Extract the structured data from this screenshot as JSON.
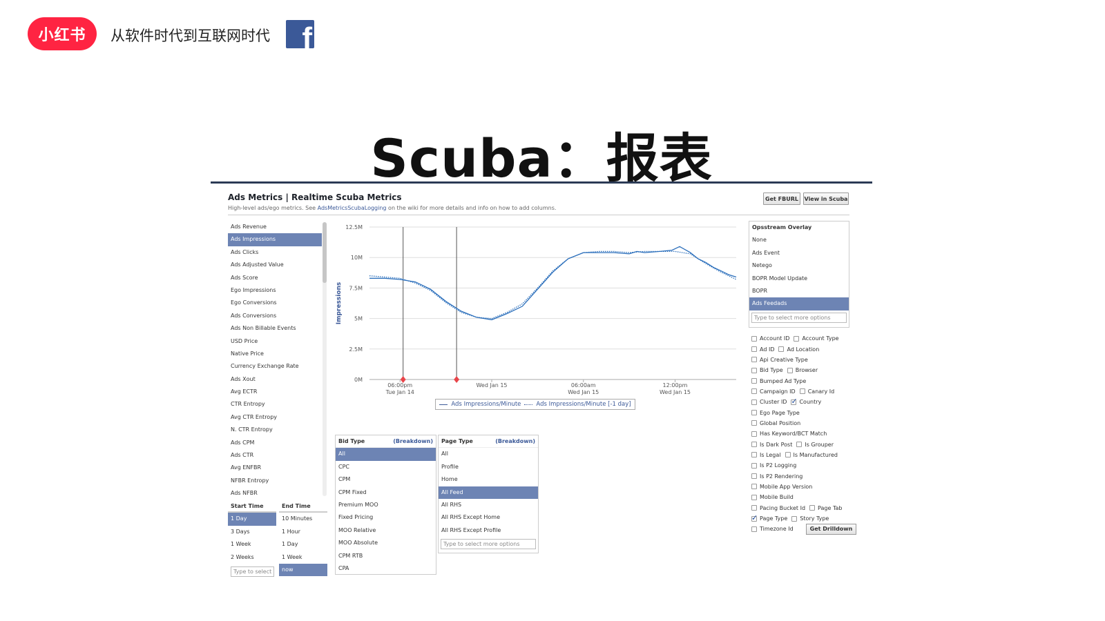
{
  "slide": {
    "brand": "小红书",
    "subtitle": "从软件时代到互联网时代",
    "title": "Scuba：报表",
    "fb_logo": "f"
  },
  "app": {
    "title": "Ads Metrics | Realtime Scuba Metrics",
    "desc_pre": "High-level ads/ego metrics. See ",
    "desc_link": "AdsMetricsScubaLogging",
    "desc_post": " on the wiki for more details and info on how to add columns.",
    "buttons": {
      "fburl": "Get FBURL",
      "view": "View in Scuba"
    }
  },
  "metrics": [
    "Ads Revenue",
    "Ads Impressions",
    "Ads Clicks",
    "Ads Adjusted Value",
    "Ads Score",
    "Ego Impressions",
    "Ego Conversions",
    "Ads Conversions",
    "Ads Non Billable Events",
    "USD Price",
    "Native Price",
    "Currency Exchange Rate",
    "Ads Xout",
    "Avg ECTR",
    "CTR Entropy",
    "Avg CTR Entropy",
    "N. CTR Entropy",
    "Ads CPM",
    "Ads CTR",
    "Avg ENFBR",
    "NFBR Entropy",
    "Ads NFBR"
  ],
  "metrics_selected": 1,
  "start_time": {
    "header": "Start Time",
    "items": [
      "1 Day",
      "3 Days",
      "1 Week",
      "2 Weeks"
    ],
    "selected": 0,
    "placeholder": "Type to select"
  },
  "end_time": {
    "header": "End Time",
    "items": [
      "10 Minutes",
      "1 Hour",
      "1 Day",
      "1 Week",
      "now"
    ],
    "selected": 4
  },
  "bid_type": {
    "header": "Bid Type",
    "breakdown": "(Breakdown)",
    "items": [
      "All",
      "CPC",
      "CPM",
      "CPM Fixed",
      "Premium MOO",
      "Fixed Pricing",
      "MOO Relative",
      "MOO Absolute",
      "CPM RTB",
      "CPA"
    ],
    "selected": 0
  },
  "page_type": {
    "header": "Page Type",
    "breakdown": "(Breakdown)",
    "items": [
      "All",
      "Profile",
      "Home",
      "All Feed",
      "All RHS",
      "All RHS Except Home",
      "All RHS Except Profile"
    ],
    "selected": 3,
    "placeholder": "Type to select more options"
  },
  "overlay": {
    "header": "Opsstream Overlay",
    "items": [
      "None",
      "Ads Event",
      "Netego",
      "BOPR Model Update",
      "BOPR",
      "Ads Feedads"
    ],
    "selected": 5,
    "placeholder": "Type to select more options"
  },
  "checkbox_rows": [
    [
      {
        "label": "Account ID",
        "checked": false
      },
      {
        "label": "Account Type",
        "checked": false
      }
    ],
    [
      {
        "label": "Ad ID",
        "checked": false
      },
      {
        "label": "Ad Location",
        "checked": false
      }
    ],
    [
      {
        "label": "Api Creative Type",
        "checked": false
      }
    ],
    [
      {
        "label": "Bid Type",
        "checked": false
      },
      {
        "label": "Browser",
        "checked": false
      }
    ],
    [
      {
        "label": "Bumped Ad Type",
        "checked": false
      }
    ],
    [
      {
        "label": "Campaign ID",
        "checked": false
      },
      {
        "label": "Canary Id",
        "checked": false
      }
    ],
    [
      {
        "label": "Cluster ID",
        "checked": false
      },
      {
        "label": "Country",
        "checked": true
      }
    ],
    [
      {
        "label": "Ego Page Type",
        "checked": false
      }
    ],
    [
      {
        "label": "Global Position",
        "checked": false
      }
    ],
    [
      {
        "label": "Has Keyword/BCT Match",
        "checked": false
      }
    ],
    [
      {
        "label": "Is Dark Post",
        "checked": false
      },
      {
        "label": "Is Grouper",
        "checked": false
      }
    ],
    [
      {
        "label": "Is Legal",
        "checked": false
      },
      {
        "label": "Is Manufactured",
        "checked": false
      }
    ],
    [
      {
        "label": "Is P2 Logging",
        "checked": false
      }
    ],
    [
      {
        "label": "Is P2 Rendering",
        "checked": false
      }
    ],
    [
      {
        "label": "Mobile App Version",
        "checked": false
      }
    ],
    [
      {
        "label": "Mobile Build",
        "checked": false
      }
    ],
    [
      {
        "label": "Pacing Bucket Id",
        "checked": false
      },
      {
        "label": "Page Tab",
        "checked": false
      }
    ],
    [
      {
        "label": "Page Type",
        "checked": true
      },
      {
        "label": "Story Type",
        "checked": false
      }
    ],
    [
      {
        "label": "Timezone Id",
        "checked": false
      }
    ]
  ],
  "drilldown_label": "Get Drilldown",
  "colors": {
    "accent": "#6d84b4",
    "line": "#2a6ebb",
    "brand": "#ff2442",
    "marker": "#e8454a"
  },
  "chart_data": {
    "type": "line",
    "ylabel": "Impressions",
    "ylim": [
      0,
      12500000
    ],
    "yticks": [
      "0M",
      "2.5M",
      "5M",
      "7.5M",
      "10M",
      "12.5M"
    ],
    "xlim": [
      0,
      24
    ],
    "xticks": [
      {
        "x": 2,
        "l1": "06:00pm",
        "l2": "Tue Jan 14"
      },
      {
        "x": 8,
        "l1": "Wed Jan 15",
        "l2": ""
      },
      {
        "x": 14,
        "l1": "06:00am",
        "l2": "Wed Jan 15"
      },
      {
        "x": 20,
        "l1": "12:00pm",
        "l2": "Wed Jan 15"
      }
    ],
    "markers": [
      2.2,
      5.7
    ],
    "series": [
      {
        "name": "Ads Impressions/Minute",
        "style": "solid",
        "x": [
          0,
          1,
          2,
          3,
          4,
          5,
          6,
          7,
          8,
          9,
          10,
          11,
          12,
          13,
          14,
          15,
          16,
          17,
          17.5,
          18,
          19,
          19.8,
          20.3,
          21,
          21.5,
          22,
          22.5,
          23,
          23.5,
          24
        ],
        "y": [
          8300000,
          8300000,
          8200000,
          8000000,
          7400000,
          6400000,
          5600000,
          5100000,
          4900000,
          5400000,
          6000000,
          7400000,
          8800000,
          9900000,
          10400000,
          10400000,
          10400000,
          10300000,
          10500000,
          10400000,
          10500000,
          10600000,
          10900000,
          10400000,
          9900000,
          9600000,
          9200000,
          8900000,
          8600000,
          8400000
        ]
      },
      {
        "name": "Ads Impressions/Minute [-1 day]",
        "style": "dotted",
        "x": [
          0,
          1,
          2,
          3,
          4,
          5,
          6,
          7,
          8,
          9,
          10,
          11,
          12,
          13,
          14,
          15,
          16,
          17,
          18,
          19,
          20,
          21,
          22,
          23,
          24
        ],
        "y": [
          8500000,
          8400000,
          8300000,
          7900000,
          7300000,
          6300000,
          5500000,
          5100000,
          5000000,
          5500000,
          6200000,
          7500000,
          8900000,
          9900000,
          10400000,
          10500000,
          10500000,
          10400000,
          10500000,
          10500000,
          10500000,
          10300000,
          9500000,
          8800000,
          8200000
        ]
      }
    ]
  }
}
